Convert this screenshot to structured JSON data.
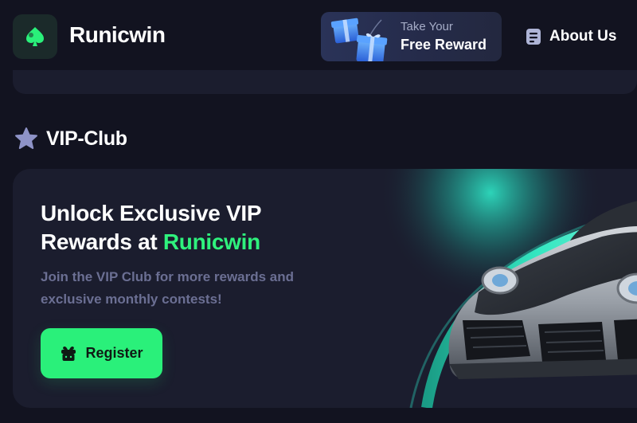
{
  "header": {
    "brand_name": "Runicwin",
    "reward": {
      "line1": "Take Your",
      "line2": "Free Reward"
    },
    "about_label": "About Us"
  },
  "section": {
    "title": "VIP-Club"
  },
  "vip": {
    "title_part1": "Unlock Exclusive VIP Rewards at ",
    "title_accent": "Runicwin",
    "description": "Join the VIP Club for more rewards and exclusive monthly contests!",
    "register_label": "Register"
  },
  "colors": {
    "background": "#121320",
    "card": "#1b1d2e",
    "accent_green": "#2af07a",
    "muted_text": "#6b6f93",
    "reward_bg": "#2a3358"
  },
  "icons": {
    "logo": "spade-icon",
    "reward": "gift-icon",
    "about": "document-icon",
    "section": "star-icon",
    "register": "gift-box-icon"
  }
}
